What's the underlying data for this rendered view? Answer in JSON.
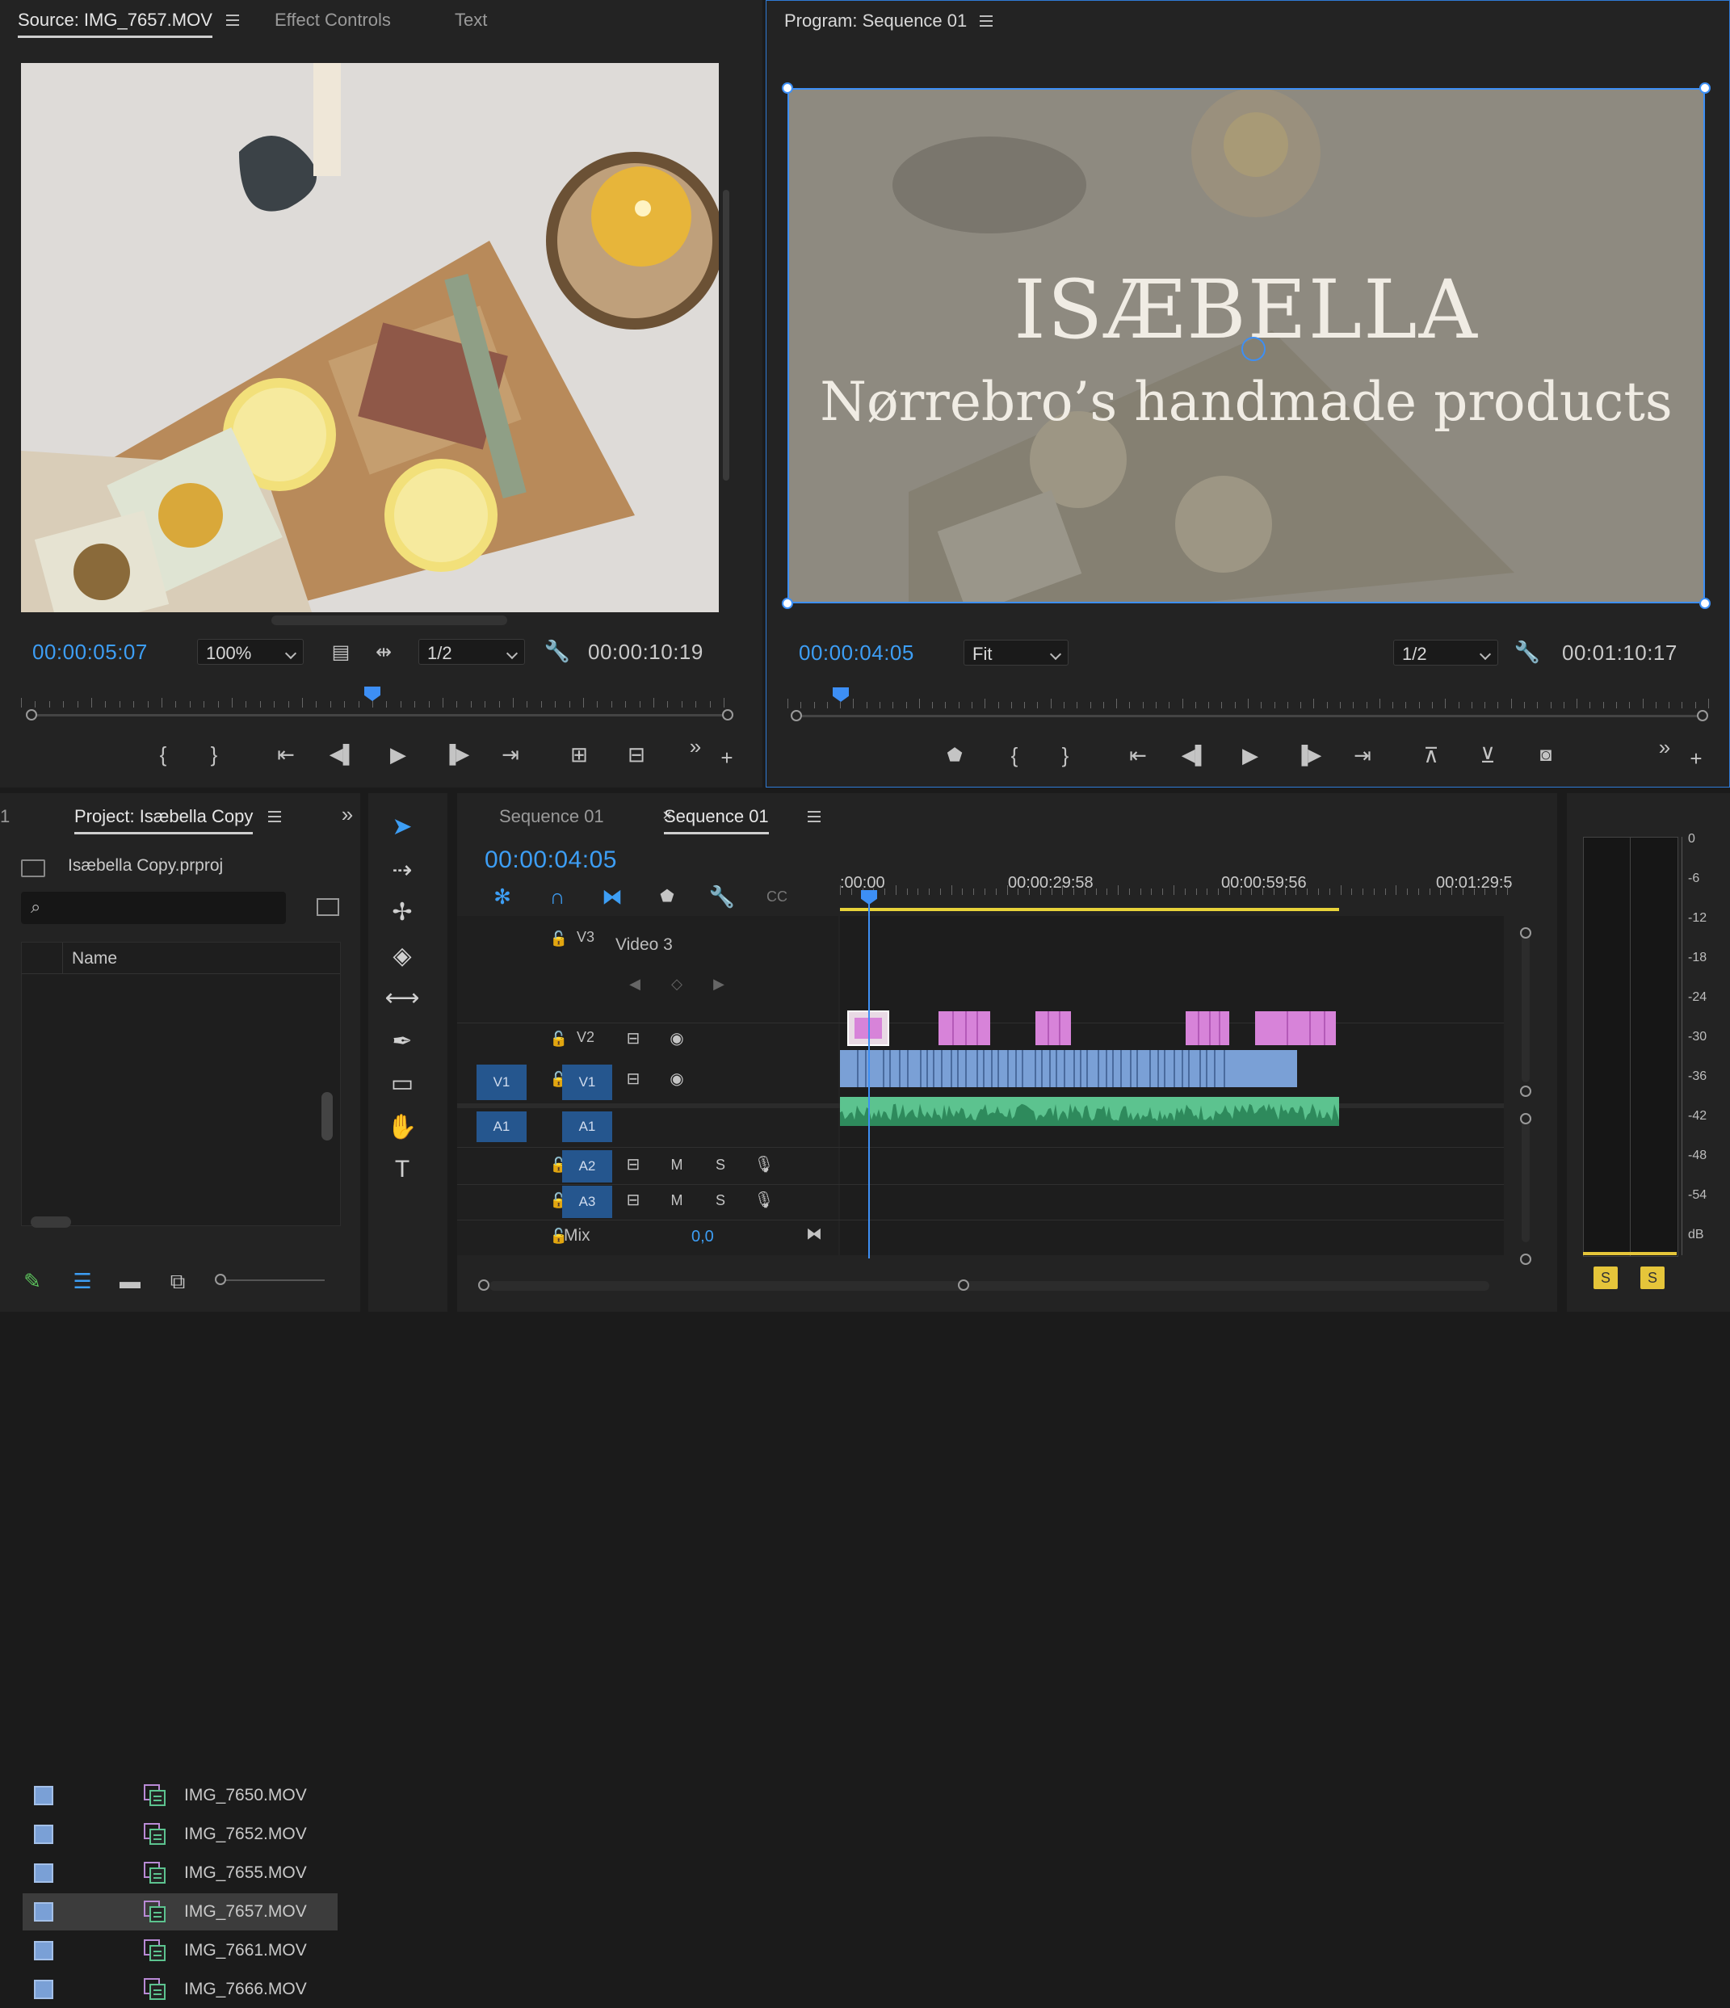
{
  "colors": {
    "accent": "#3d9ef5",
    "clip_video": "#7aa0d6",
    "clip_graphic": "#d783d9",
    "clip_audio": "#5cc38f",
    "solo_yellow": "#e5c53a"
  },
  "source": {
    "tab_source": "Source: IMG_7657.MOV",
    "tab_effects": "Effect Controls",
    "tab_text": "Text",
    "timecode": "00:00:05:07",
    "zoom": "100%",
    "resolution": "1/2",
    "duration": "00:00:10:19",
    "playhead_fraction": 0.5
  },
  "program": {
    "tab": "Program: Sequence 01",
    "title_line1": "ISÆBELLA",
    "title_line2": "Nørrebro’s handmade products",
    "timecode": "00:00:04:05",
    "fit": "Fit",
    "resolution": "1/2",
    "duration": "00:01:10:17",
    "playhead_fraction": 0.06
  },
  "project": {
    "left_number": "1",
    "tab": "Project: Isæbella Copy",
    "file": "Isæbella Copy.prproj",
    "search_placeholder": "",
    "col_name": "Name",
    "items": [
      {
        "name": "IMG_7650.MOV"
      },
      {
        "name": "IMG_7652.MOV"
      },
      {
        "name": "IMG_7655.MOV"
      },
      {
        "name": "IMG_7657.MOV",
        "selected": true
      },
      {
        "name": "IMG_7661.MOV"
      },
      {
        "name": "IMG_7666.MOV"
      }
    ]
  },
  "timeline": {
    "tab_inactive": "Sequence 01",
    "tab_active": "Sequence 01",
    "timecode": "00:00:04:05",
    "ruler": [
      ":00:00",
      "00:00:29:58",
      "00:00:59:56",
      "00:01:29:5"
    ],
    "tracks": {
      "v3": "V3",
      "v3_name": "Video 3",
      "v2": "V2",
      "v1_src": "V1",
      "v1": "V1",
      "a1_src": "A1",
      "a1": "A1",
      "a2": "A2",
      "a3": "A3",
      "mix": "Mix",
      "mix_value": "0,0",
      "m": "M",
      "s": "S"
    }
  },
  "meter": {
    "labels": [
      "0",
      "-6",
      "-12",
      "-18",
      "-24",
      "-30",
      "-36",
      "-42",
      "-48",
      "-54",
      "dB"
    ],
    "solo": [
      "S",
      "S"
    ]
  }
}
